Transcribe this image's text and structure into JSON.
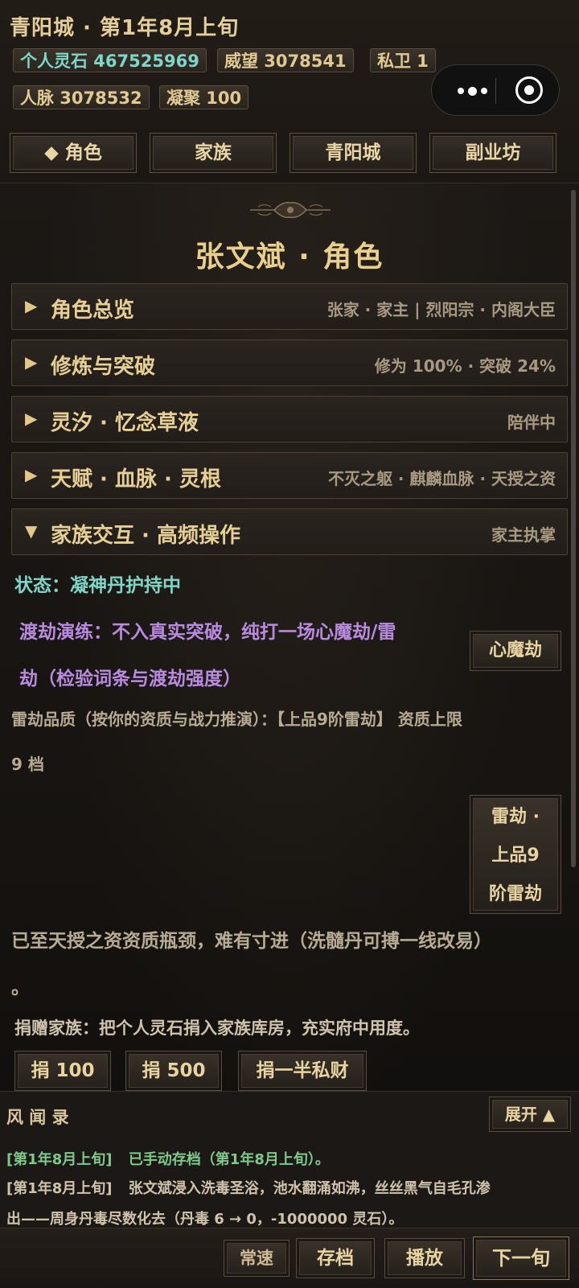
{
  "header": {
    "title": "青阳城 · 第1年8月上旬",
    "stats": {
      "spirit_stones": "个人灵石 467525969",
      "prestige": "威望 3078541",
      "guards": "私卫 1",
      "connections": "人脉 3078532",
      "cohesion": "凝聚 100"
    }
  },
  "nav_tabs": {
    "character": "◆ 角色",
    "family": "家族",
    "city": "青阳城",
    "workshop": "副业坊"
  },
  "page_title": "张文斌 · 角色",
  "sections": [
    {
      "name": "角色总览",
      "meta": "张家 · 家主  |  烈阳宗 · 内阁大臣",
      "arrow": "▶"
    },
    {
      "name": "修炼与突破",
      "meta": "修为 100% · 突破 24%",
      "arrow": "▶"
    },
    {
      "name": "灵汐 · 忆念草液",
      "meta": "陪伴中",
      "arrow": "▶"
    },
    {
      "name": "天赋 · 血脉 · 灵根",
      "meta": "不灭之躯 · 麒麟血脉 · 天授之资",
      "arrow": "▶"
    },
    {
      "name": "家族交互 · 高频操作",
      "meta": "家主执掌",
      "arrow": "▼"
    }
  ],
  "content": {
    "status": "状态：凝神丹护持中",
    "drill_line1": "渡劫演练：不入真实突破，纯打一场心魔劫/雷",
    "drill_line2": "劫（检验词条与渡劫强度）",
    "heart_demon_button": "心魔劫",
    "thunder_quality_line1": "雷劫品质（按你的资质与战力推演）：【上品9阶雷劫】  资质上限",
    "thunder_quality_line2": "9 档",
    "thunder_button_line1": "雷劫 ·",
    "thunder_button_line2": "上品9",
    "thunder_button_line3": "阶雷劫",
    "bottleneck_line1": "已至天授之资资质瓶颈，难有寸进（洗髓丹可搏一线改易）",
    "bottleneck_line2": "。",
    "donate_text": "捐赠家族：把个人灵石捐入家族库房，充实府中用度。",
    "donate_buttons": [
      "捐 100",
      "捐 500",
      "捐一半私财"
    ]
  },
  "log": {
    "title": "风 闻 录",
    "expand_button": "展开 ▲",
    "entries": [
      {
        "time": "[第1年8月上旬]",
        "text": "已手动存档（第1年8月上旬）。"
      },
      {
        "time": "[第1年8月上旬]",
        "text": "张文斌浸入洗毒圣浴，池水翻涌如沸，丝丝黑气自毛孔渗"
      },
      {
        "time": "",
        "text": "出——周身丹毒尽数化去（丹毒 6 → 0，-1000000 灵石）。"
      }
    ]
  },
  "footer": {
    "speed": "常速",
    "save": "存档",
    "play": "播放",
    "next": "下一旬"
  },
  "colors": {
    "gold": "#e6cf94",
    "cyan": "#7ed6c8",
    "purple": "#b98be0",
    "green": "#7fc98a",
    "gray_text": "#a89a82"
  }
}
